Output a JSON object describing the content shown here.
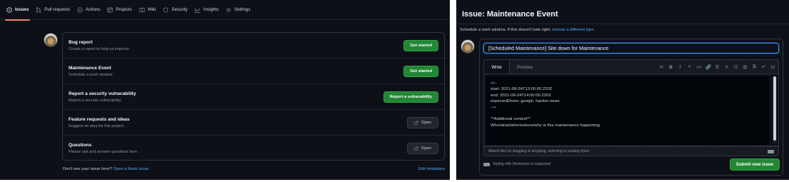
{
  "left": {
    "repo_tabs": [
      {
        "label": "Issues",
        "icon": "issue-opened-icon",
        "active": true
      },
      {
        "label": "Pull requests",
        "icon": "git-pull-request-icon",
        "active": false
      },
      {
        "label": "Actions",
        "icon": "play-icon",
        "active": false
      },
      {
        "label": "Projects",
        "icon": "table-icon",
        "active": false
      },
      {
        "label": "Wiki",
        "icon": "book-icon",
        "active": false
      },
      {
        "label": "Security",
        "icon": "shield-icon",
        "active": false
      },
      {
        "label": "Insights",
        "icon": "graph-icon",
        "active": false
      },
      {
        "label": "Settings",
        "icon": "gear-icon",
        "active": false
      }
    ],
    "templates": [
      {
        "title": "Bug report",
        "description": "Create a report to help us improve",
        "button": "Get started"
      },
      {
        "title": "Maintenance Event",
        "description": "Schedule a work window",
        "button": "Get started"
      },
      {
        "title": "Report a security vulnerability",
        "description": "Report a security vulnerability.",
        "button": "Report a vulnerability"
      },
      {
        "title": "Feature requests and ideas",
        "description": "Suggest an idea for this project",
        "button": "Open"
      },
      {
        "title": "Questions",
        "description": "Please ask and answer questions here",
        "button": "Open"
      }
    ],
    "footer": {
      "prompt": "Don't see your issue here?",
      "blank_link": "Open a blank issue.",
      "edit_templates": "Edit templates"
    }
  },
  "right": {
    "heading": "Issue: Maintenance Event",
    "schedule_prefix": "Schedule a work window. If this doesn't look right,",
    "schedule_link": "choose a different type.",
    "title_value": "[Scheduled Maintenance] Site down for Maintenance",
    "tab_write": "Write",
    "tab_preview": "Preview",
    "toolbar_icons": [
      "heading-icon",
      "bold-icon",
      "italic-icon",
      "quote-icon",
      "code-icon",
      "link-icon",
      "unordered-list-icon",
      "ordered-list-icon",
      "task-list-icon",
      "mention-icon",
      "reference-icon",
      "reply-icon",
      "fullscreen-icon"
    ],
    "toolbar_glyphs": [
      "H",
      "B",
      "I",
      "❝",
      "<>",
      "🔗",
      "☰",
      "≡",
      "☷",
      "@",
      "⧉",
      "↶",
      "⊡"
    ],
    "body_value": "<!--\nstart: 2021-08-24T13:00:00.220Z\nend: 2021-08-24T14:00:00.220Z\nexpectedDown: google, hacker-news\n-->\n\n**Additional context**\nWho/what/when/where/why is this maintenance happening",
    "attach_text": "Attach files by dragging & dropping, selecting or pasting them.",
    "styling_note": "Styling with Markdown is supported",
    "submit_label": "Submit new issue"
  },
  "colors": {
    "background": "#0d1117",
    "border": "#30363d",
    "accent_blue": "#58a6ff",
    "green_button": "#238636",
    "active_tab_underline": "#f78166"
  }
}
